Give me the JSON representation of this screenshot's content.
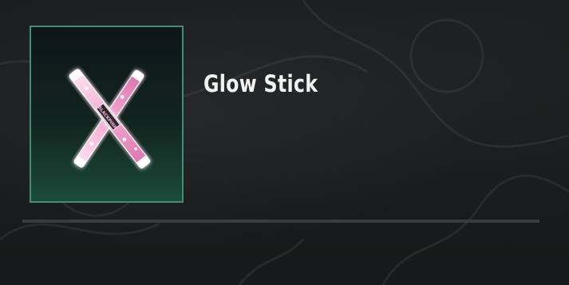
{
  "item": {
    "name": "Glow Stick",
    "icon": "glow-stick-icon",
    "stick_label": "BLACKPINK"
  },
  "colors": {
    "card_border": "#3f8f72",
    "card_gradient_top": "#0e151a",
    "card_gradient_bottom": "#1c4b3a",
    "stick_pink": "#f4a8d0",
    "text": "#f2f2f2",
    "background": "#1a1b1c"
  }
}
